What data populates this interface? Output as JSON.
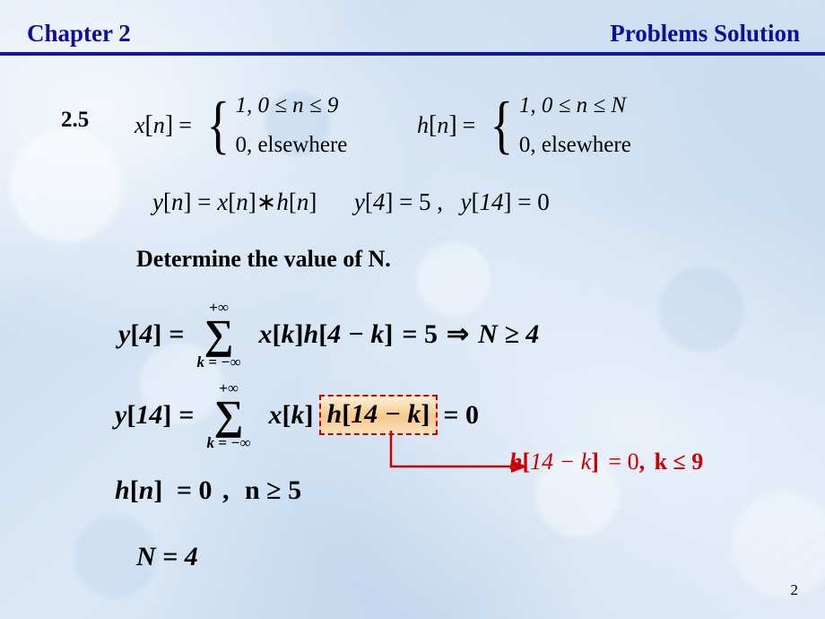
{
  "header": {
    "chapter": "Chapter 2",
    "section": "Problems Solution",
    "rule_color": "#14189c",
    "text_color": "#0b0f9c"
  },
  "slide": {
    "item_number": "2.5",
    "page_number": "2",
    "definitions": [
      {
        "name": "x-definition",
        "lhs_func": "x",
        "lhs_arg": "n",
        "equals": "=",
        "cases": [
          "1,  0 ≤ n ≤ 9",
          "0,  elsewhere"
        ]
      },
      {
        "name": "h-definition",
        "lhs_func": "h",
        "lhs_arg": "n",
        "equals": "=",
        "cases": [
          "1,  0 ≤ n ≤ N",
          "0,  elsewhere"
        ]
      }
    ],
    "convolution_line": "y[n] = x[n] * h[n]      y[4] = 5 ,  y[14] = 0",
    "convolution_parts": {
      "y_n": "y",
      "eq": "=",
      "x_n": "x",
      "star": "∗",
      "h_n": "h",
      "y4": "y",
      "y4_val": "= 5",
      "comma": ",",
      "y14": "y",
      "y14_val": "= 0"
    },
    "determine_text": "Determine the value of N.",
    "equation_y4": {
      "lhs": "y",
      "lhs_index": "4",
      "eq": "=",
      "sum_upper": "+∞",
      "sigma": "∑",
      "sum_lower": "k = −∞",
      "summand_x": "x",
      "summand_x_idx": "k",
      "summand_h": "h",
      "summand_h_idx": "4 − k",
      "result": "= 5",
      "implies": "⇒",
      "conclusion": "N ≥ 4"
    },
    "equation_y14": {
      "lhs": "y",
      "lhs_index": "14",
      "eq": "=",
      "sum_upper": "+∞",
      "sigma": "∑",
      "sum_lower": "k = −∞",
      "summand_x": "x",
      "summand_x_idx": "k",
      "boxed_h": "h",
      "boxed_h_idx": "14 − k",
      "result": "= 0",
      "box_border_color": "#cc0000",
      "box_fill_color": "#f6c88a"
    },
    "annotation": {
      "func": "h",
      "arg": "14 − k",
      "equals_zero": "= 0",
      "comma": ",",
      "condition": "k ≤ 9",
      "color": "#cc0000"
    },
    "equation_hn": {
      "func": "h",
      "arg": "n",
      "equals_zero": "= 0",
      "comma": ",",
      "condition": "n ≥ 5"
    },
    "equation_N": {
      "text": "N = 4"
    }
  }
}
